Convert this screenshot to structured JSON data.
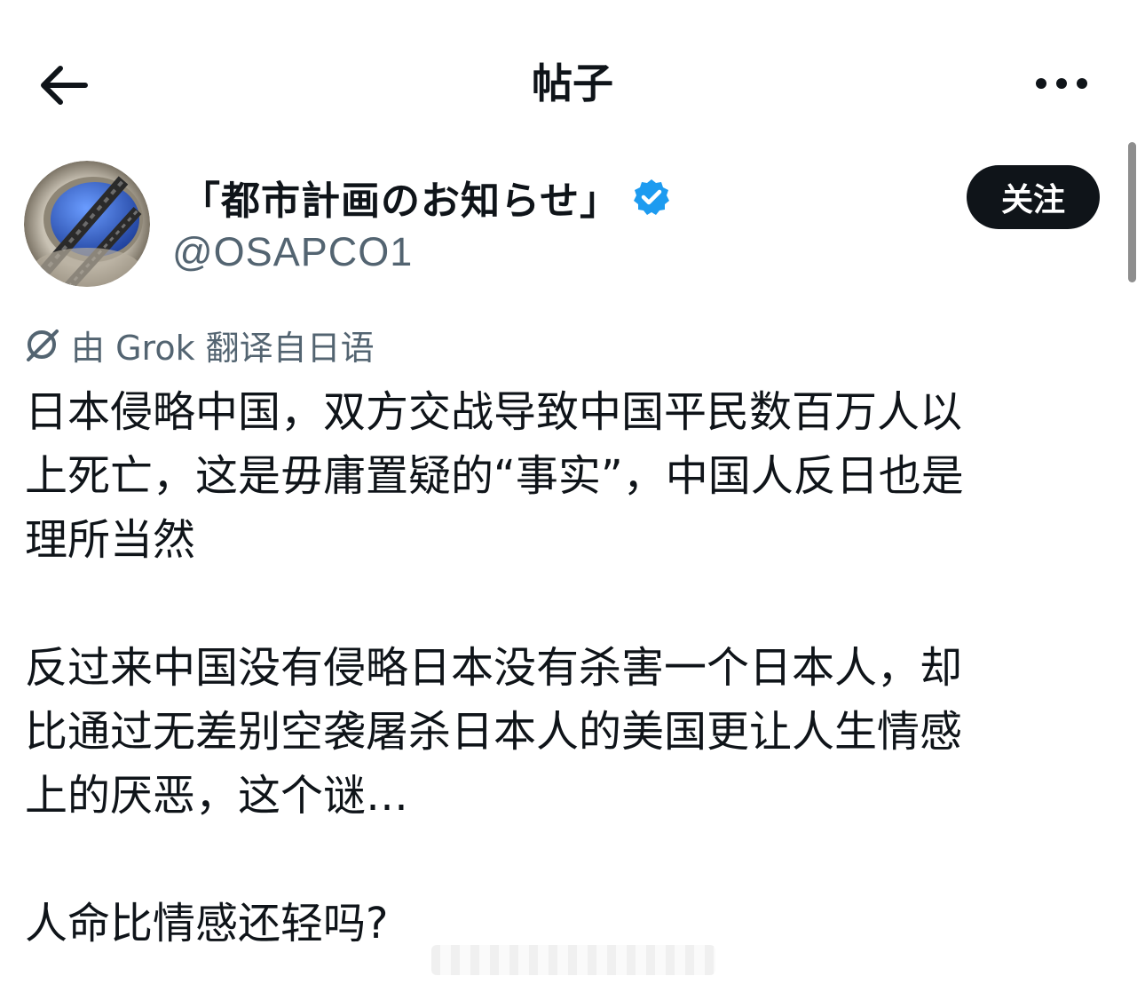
{
  "header": {
    "title": "帖子",
    "back_icon": "arrow-left-icon",
    "more_icon": "more-horizontal-icon"
  },
  "author": {
    "display_name": "「都市計画のお知らせ」",
    "handle": "@OSAPCO1",
    "verified_icon": "verified-badge-icon",
    "verified_color": "#1d9bf0",
    "avatar_icon": "avatar-image"
  },
  "follow_button": {
    "label": "关注"
  },
  "translation": {
    "icon": "grok-icon",
    "label": "由 Grok 翻译自日语"
  },
  "post": {
    "paragraphs": [
      "日本侵略中国，双方交战导致中国平民数百万人以\n上死亡，这是毋庸置疑的“事实”，中国人反日也是\n理所当然",
      "反过来中国没有侵略日本没有杀害一个日本人，却\n比通过无差别空袭屠杀日本人的美国更让人生情感\n上的厌恶，这个谜…",
      "人命比情感还轻吗?"
    ]
  },
  "colors": {
    "text_primary": "#0f1419",
    "text_secondary": "#536471",
    "button_bg": "#0f1419",
    "button_text": "#ffffff"
  }
}
